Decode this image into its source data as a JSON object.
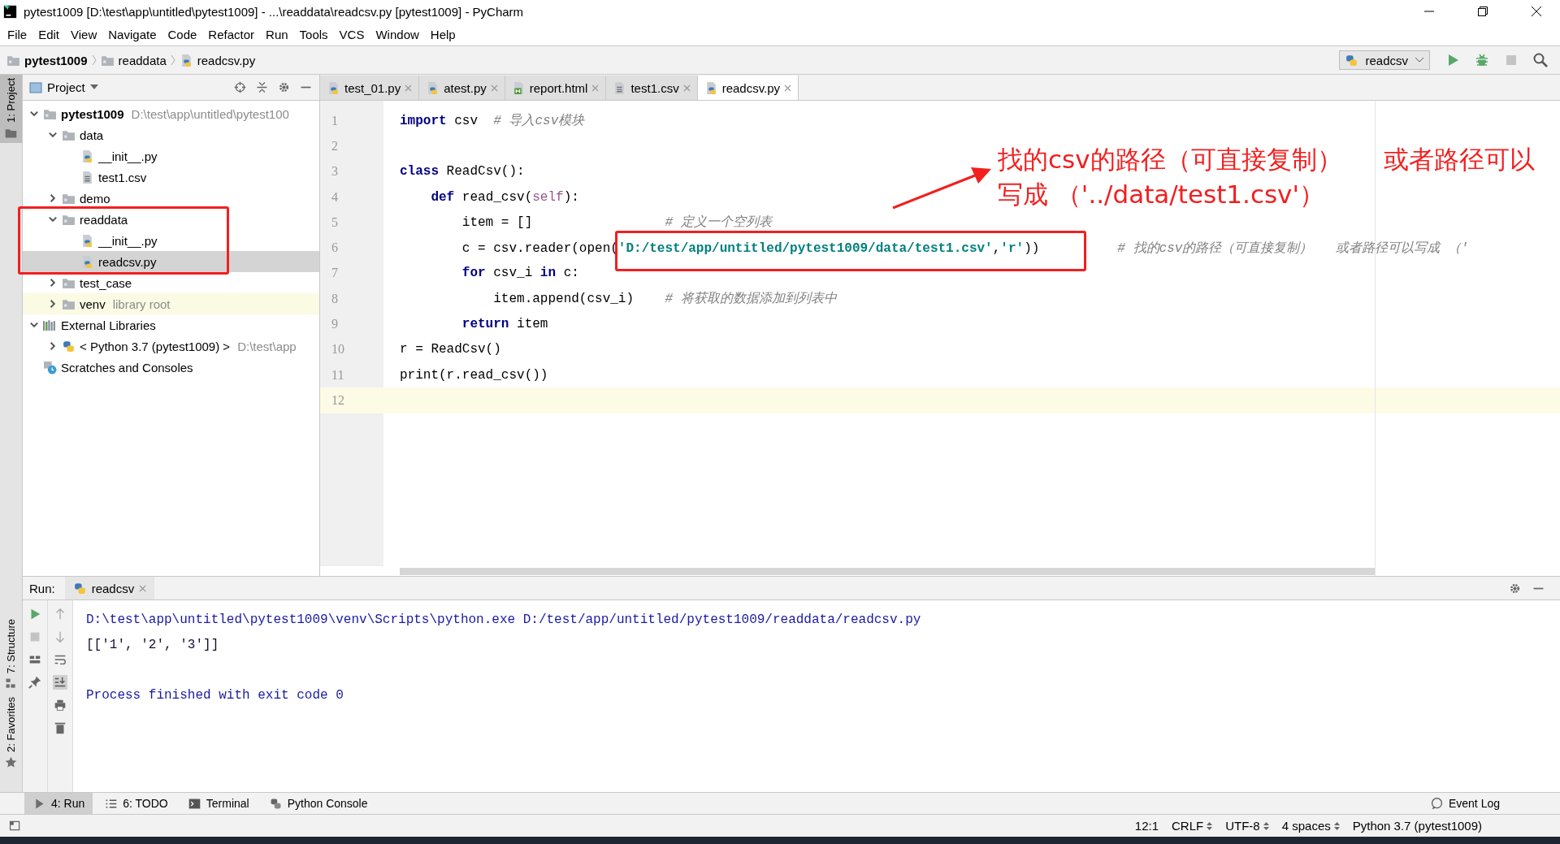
{
  "window": {
    "title": "pytest1009 [D:\\test\\app\\untitled\\pytest1009] - ...\\readdata\\readcsv.py [pytest1009] - PyCharm"
  },
  "menu": [
    "File",
    "Edit",
    "View",
    "Navigate",
    "Code",
    "Refactor",
    "Run",
    "Tools",
    "VCS",
    "Window",
    "Help"
  ],
  "breadcrumbs": [
    {
      "label": "pytest1009",
      "kind": "project"
    },
    {
      "label": "readdata",
      "kind": "folder"
    },
    {
      "label": "readcsv.py",
      "kind": "py"
    }
  ],
  "run_config": {
    "label": "readcsv"
  },
  "tool_stripes": [
    {
      "label": "1: Project",
      "selected": true,
      "kind": "project"
    },
    {
      "label": "7: Structure",
      "selected": false,
      "kind": "structure"
    },
    {
      "label": "2: Favorites",
      "selected": false,
      "kind": "favorites"
    }
  ],
  "project_panel": {
    "title": "Project",
    "tree": [
      {
        "label": "pytest1009",
        "hint": "D:\\test\\app\\untitled\\pytest100",
        "kind": "root",
        "expanded": true,
        "selected": false,
        "children": [
          {
            "label": "data",
            "kind": "folder",
            "expanded": true,
            "selected": false,
            "children": [
              {
                "label": "__init__.py",
                "kind": "py",
                "selected": false
              },
              {
                "label": "test1.csv",
                "kind": "csv",
                "selected": false
              }
            ]
          },
          {
            "label": "demo",
            "kind": "folder",
            "expanded": false,
            "selected": false
          },
          {
            "label": "readdata",
            "kind": "folder",
            "expanded": true,
            "selected": false,
            "children": [
              {
                "label": "__init__.py",
                "kind": "py",
                "selected": false
              },
              {
                "label": "readcsv.py",
                "kind": "py",
                "selected": true
              }
            ]
          },
          {
            "label": "test_case",
            "kind": "folder",
            "expanded": false,
            "selected": false
          },
          {
            "label": "venv",
            "hint": "library root",
            "kind": "folder",
            "expanded": false,
            "selected": false
          }
        ]
      },
      {
        "label": "External Libraries",
        "kind": "lib",
        "expanded": true,
        "selected": false,
        "children": [
          {
            "label": "< Python 3.7 (pytest1009) >",
            "hint": "D:\\test\\app",
            "kind": "python",
            "expanded": false,
            "selected": false
          }
        ]
      },
      {
        "label": "Scratches and Consoles",
        "kind": "scratch",
        "selected": false
      }
    ]
  },
  "editor_tabs": [
    {
      "label": "test_01.py",
      "kind": "py",
      "selected": false
    },
    {
      "label": "atest.py",
      "kind": "py",
      "selected": false
    },
    {
      "label": "report.html",
      "kind": "html",
      "selected": false
    },
    {
      "label": "test1.csv",
      "kind": "csv",
      "selected": false
    },
    {
      "label": "readcsv.py",
      "kind": "py",
      "selected": true
    }
  ],
  "code": [
    {
      "number": "1",
      "current": false,
      "tokens": [
        {
          "kind": "kw",
          "text": "import"
        },
        {
          "kind": "plain",
          "text": " csv  "
        },
        {
          "kind": "cmt",
          "text": "# 导入csv模块"
        }
      ]
    },
    {
      "number": "2",
      "current": false
    },
    {
      "number": "3",
      "current": false,
      "tokens": [
        {
          "kind": "kw",
          "text": "class"
        },
        {
          "kind": "plain",
          "text": " ReadCsv():"
        }
      ]
    },
    {
      "number": "4",
      "current": false,
      "tokens": [
        {
          "kind": "kw",
          "text": "    def"
        },
        {
          "kind": "plain",
          "text": " read_csv("
        },
        {
          "kind": "self",
          "text": "self"
        },
        {
          "kind": "plain",
          "text": "):"
        }
      ]
    },
    {
      "number": "5",
      "current": false,
      "tokens": [
        {
          "kind": "plain",
          "text": "        item = []                 "
        },
        {
          "kind": "cmt",
          "text": "# 定义一个空列表"
        }
      ]
    },
    {
      "number": "6",
      "current": false,
      "tokens": [
        {
          "kind": "plain",
          "text": "        c = csv.reader(open("
        },
        {
          "kind": "str",
          "text": "'D:/test/app/untitled/pytest1009/data/test1.csv'"
        },
        {
          "kind": "plain",
          "text": ","
        },
        {
          "kind": "str",
          "text": "'r'"
        },
        {
          "kind": "plain",
          "text": "))          "
        },
        {
          "kind": "cmt",
          "text": "# 找的csv的路径（可直接复制）   或者路径可以写成 （'"
        }
      ]
    },
    {
      "number": "7",
      "current": false,
      "tokens": [
        {
          "kind": "kw",
          "text": "        for"
        },
        {
          "kind": "plain",
          "text": " csv_i "
        },
        {
          "kind": "kw",
          "text": "in"
        },
        {
          "kind": "plain",
          "text": " c:"
        }
      ]
    },
    {
      "number": "8",
      "current": false,
      "tokens": [
        {
          "kind": "plain",
          "text": "            item.append(csv_i)    "
        },
        {
          "kind": "cmt",
          "text": "# 将获取的数据添加到列表中"
        }
      ]
    },
    {
      "number": "9",
      "current": false,
      "tokens": [
        {
          "kind": "kw",
          "text": "        return"
        },
        {
          "kind": "plain",
          "text": " item"
        }
      ]
    },
    {
      "number": "10",
      "current": false,
      "tokens": [
        {
          "kind": "plain",
          "text": "r = ReadCsv()"
        }
      ]
    },
    {
      "number": "11",
      "current": false,
      "tokens": [
        {
          "kind": "plain",
          "text": "print(r.read_csv())"
        }
      ]
    },
    {
      "number": "12",
      "current": true
    }
  ],
  "callouts": [
    {
      "text": "找的csv的路径（可直接复制）"
    },
    {
      "text": "写成 （'../data/test1.csv'）"
    },
    {
      "text": "或者路径可以"
    }
  ],
  "run_panel": {
    "label": "Run:",
    "tab": "readcsv",
    "output": [
      {
        "kind": "command",
        "text": "D:\\test\\app\\untitled\\pytest1009\\venv\\Scripts\\python.exe D:/test/app/untitled/pytest1009/readdata/readcsv.py"
      },
      {
        "kind": "result",
        "text": "[['1', '2', '3']]"
      },
      {
        "kind": "exit",
        "text": "Process finished with exit code 0"
      }
    ]
  },
  "bottom_tabs": [
    {
      "label": "4: Run",
      "kind": "run",
      "selected": true
    },
    {
      "label": "6: TODO",
      "kind": "todo",
      "selected": false
    },
    {
      "label": "Terminal",
      "kind": "terminal",
      "selected": false
    },
    {
      "label": "Python Console",
      "kind": "console",
      "selected": false
    }
  ],
  "event_log": "Event Log",
  "status_bar": [
    {
      "text": "12:1",
      "kind": "plain"
    },
    {
      "text": "CRLF",
      "kind": "select"
    },
    {
      "text": "UTF-8",
      "kind": "select"
    },
    {
      "text": "4 spaces",
      "kind": "select"
    },
    {
      "text": "Python 3.7 (pytest1009)",
      "kind": "plain"
    }
  ]
}
